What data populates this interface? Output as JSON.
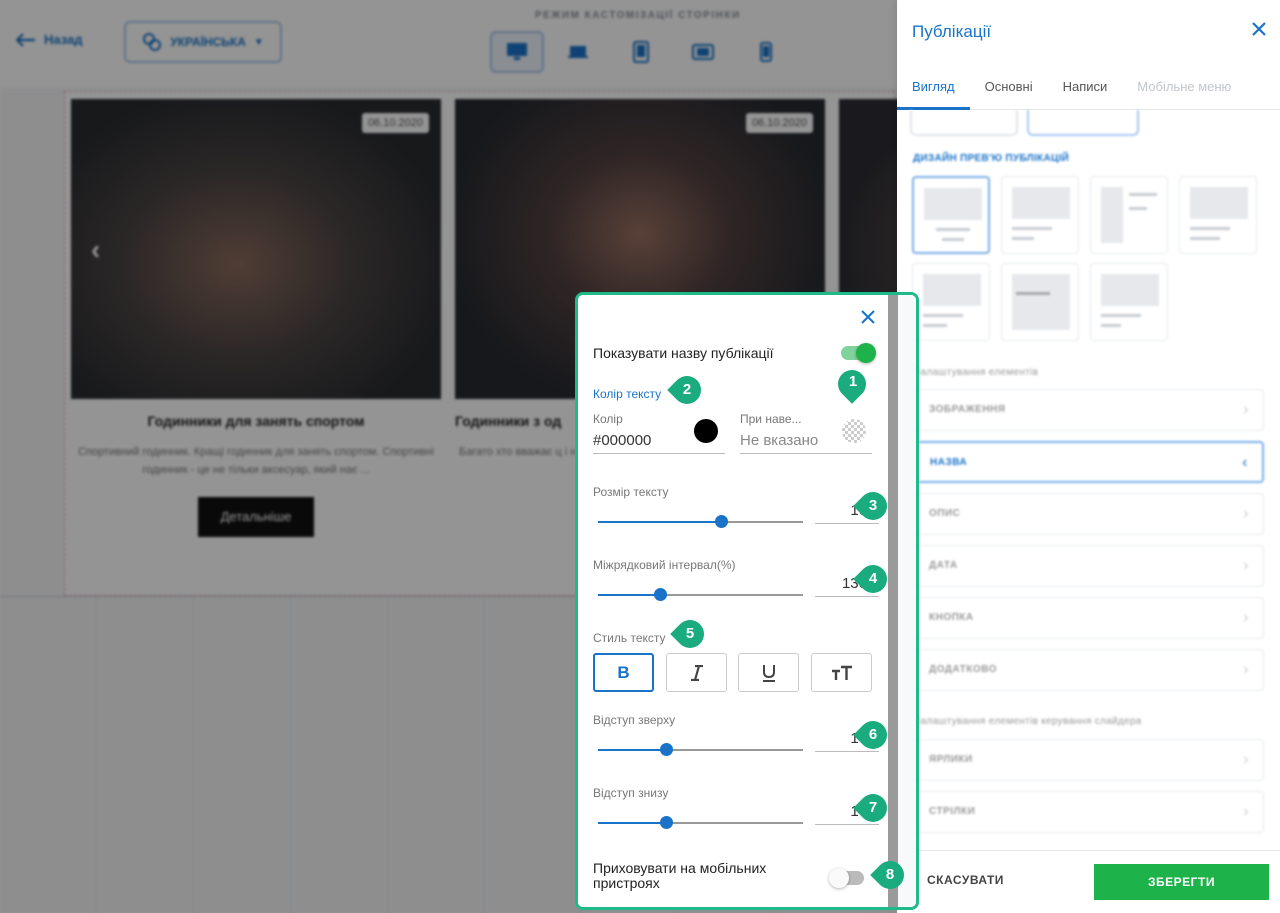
{
  "topbar": {
    "back_label": "Назад",
    "language_label": "УКРАЇНСЬКА",
    "mode_label": "РЕЖИМ КАСТОМІЗАЦІЇ СТОРІНКИ"
  },
  "cards": [
    {
      "date": "06.10.2020",
      "title": "Годинники для занять спортом",
      "description": "Спортивний годинник. Кращі годинник для занять спортом. Спортивні годинник - це не тільки аксесуар, який нає ...",
      "button": "Детальніше"
    },
    {
      "date": "06.10.2020",
      "title": "Годинники з од",
      "description": "Багато хто вважає ц і нетрадиційним, з"
    }
  ],
  "right_panel": {
    "title": "Публікації",
    "tabs": [
      "Вигляд",
      "Основні",
      "Написи",
      "Мобільне меню"
    ],
    "active_tab": 0,
    "design_label": "ДИЗАЙН ПРЕВ'Ю ПУБЛІКАЦІЙ",
    "customize_elements_label": "Налаштування елементів",
    "elements": [
      "ЗОБРАЖЕННЯ",
      "НАЗВА",
      "ОПИС",
      "ДАТА",
      "КНОПКА",
      "ДОДАТКОВО"
    ],
    "active_element": 1,
    "slider_controls_label": "Налаштування елементів керування слайдера",
    "slider_controls": [
      "ЯРЛИКИ",
      "СТРІЛКИ"
    ],
    "cancel_label": "СКАСУВАТИ",
    "save_label": "ЗБЕРЕГТИ"
  },
  "popup": {
    "show_title_label": "Показувати назву публікації",
    "show_title_on": true,
    "text_color_label": "Колір тексту",
    "color_label": "Колір",
    "color_value": "#000000",
    "hover_label": "При наве...",
    "hover_value": "Не вказано",
    "font_size_label": "Розмір тексту",
    "font_size_value": "16",
    "font_size_fraction": 0.6,
    "line_height_label": "Міжрядковий інтервал(%)",
    "line_height_value": "130",
    "line_height_fraction": 0.3,
    "text_style_label": "Стиль тексту",
    "style_buttons": [
      {
        "label": "B",
        "icon": "bold-icon",
        "active": true
      },
      {
        "label": "I",
        "icon": "italic-icon",
        "active": false
      },
      {
        "label": "U",
        "icon": "underline-icon",
        "active": false
      },
      {
        "label": "тТ",
        "icon": "text-case-icon",
        "active": false
      }
    ],
    "padding_top_label": "Відступ зверху",
    "padding_top_value": "10",
    "padding_top_fraction": 0.33,
    "padding_bottom_label": "Відступ знизу",
    "padding_bottom_value": "10",
    "padding_bottom_fraction": 0.33,
    "hide_mobile_label": "Приховувати на мобільних пристроях",
    "hide_mobile_on": false
  },
  "markers": [
    "1",
    "2",
    "3",
    "4",
    "5",
    "6",
    "7",
    "8"
  ],
  "colors": {
    "accent": "#1a73c8",
    "marker": "#1aab7e",
    "popup_border": "#20b98a",
    "save_button": "#1db34a",
    "toggle_on": "#1db34a"
  }
}
